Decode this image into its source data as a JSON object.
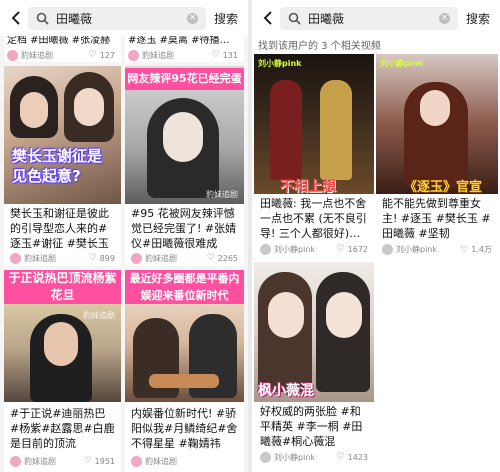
{
  "search": {
    "query": "田曦薇",
    "search_label": "搜索",
    "clear_symbol": "×"
  },
  "left": {
    "cards": [
      {
        "caption_top": "定档 #田曦薇 #张凌赫",
        "likes": "127"
      },
      {
        "caption_top": "#逐玉 #莫离 #待播…",
        "likes": "131"
      },
      {
        "thumb_text": "樊长玉谢征是见色起意?",
        "caption": "樊长玉和谢征是彼此的引导型恋人来的#逐玉#谢征 #樊长玉 #田…",
        "likes": "899",
        "watermark": "豹妹追剧"
      },
      {
        "bar_text": "网友辣评95花已经完蛋",
        "caption": "#95 花被网友辣评憾觉已经完蛋了! #张婧仪#田曦薇很难成为…",
        "likes": "2265",
        "watermark": "豹妹追剧"
      },
      {
        "bar_text": "于正说热巴顶流杨紫花旦",
        "caption": "#于正说#迪丽热巴 #杨紫#赵露思#白鹿是目前的顶流",
        "likes": "1951",
        "watermark": "豹妹追剧"
      },
      {
        "bar_text": "最近好多圈都是平番内娱迎来番位新时代",
        "caption": "内娱番位新时代! #骄阳似我#月鳞绮纪#舍不得星星 #鞠婧祎#…",
        "watermark": "豹妹追剧"
      }
    ],
    "author": "豹妹追剧"
  },
  "right": {
    "result_count": "找到该用户的 3 个相关视频",
    "author": "刘小静pink",
    "cards": [
      {
        "overlay": "不相上想",
        "caption": "田曦薇: 我一点也不舍一点也不累 (无不良引导! 三个人都很好)…",
        "likes": "1672",
        "logo": "刘小静pink"
      },
      {
        "overlay": "《逐玉》官宣",
        "caption": "能不能先做到尊重女主! #逐玉 #樊长玉 #田曦薇 #坚韧",
        "likes": "1.4万",
        "logo": "刘小静pink"
      },
      {
        "overlay": "枫小薇混",
        "caption": "好权威的两张脸 #和平精英 #李一桐 #田曦薇#桐心薇混",
        "likes": "1423"
      }
    ]
  },
  "colors": {
    "pink": "#ff4fa0",
    "accent_purple": "#7a5cff"
  }
}
